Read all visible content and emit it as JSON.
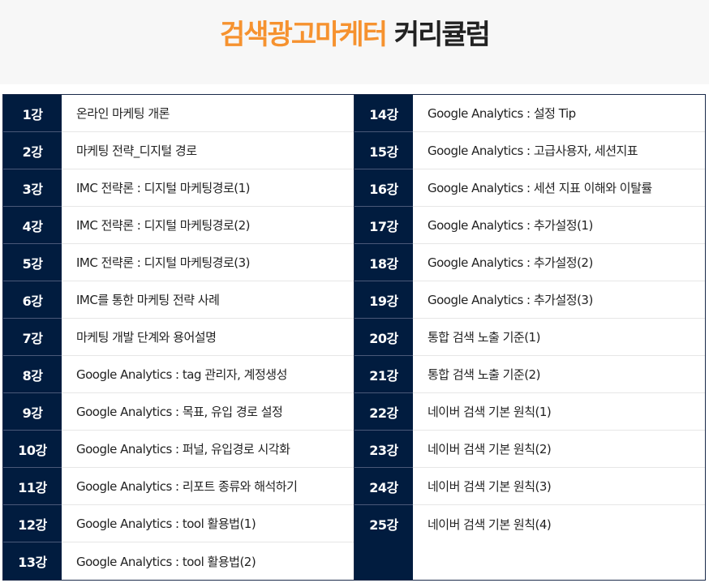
{
  "header": {
    "title_accent": "검색광고마케터",
    "title_rest": "커리큘럼",
    "accent_color": "#f6922f",
    "number_cell_color": "#011c3f"
  },
  "lessons_left": [
    {
      "num": "1강",
      "title": "온라인 마케팅 개론"
    },
    {
      "num": "2강",
      "title": "마케팅 전략_디지털 경로"
    },
    {
      "num": "3강",
      "title": "IMC 전략론 : 디지털 마케팅경로(1)"
    },
    {
      "num": "4강",
      "title": "IMC 전략론 : 디지털 마케팅경로(2)"
    },
    {
      "num": "5강",
      "title": "IMC 전략론 : 디지털 마케팅경로(3)"
    },
    {
      "num": "6강",
      "title": "IMC를 통한 마케팅 전략 사례"
    },
    {
      "num": "7강",
      "title": "마케팅 개발 단계와 용어설명"
    },
    {
      "num": "8강",
      "title": "Google Analytics : tag 관리자, 계정생성"
    },
    {
      "num": "9강",
      "title": "Google Analytics : 목표, 유입 경로 설정"
    },
    {
      "num": "10강",
      "title": "Google Analytics : 퍼널, 유입경로 시각화"
    },
    {
      "num": "11강",
      "title": "Google Analytics : 리포트 종류와 해석하기"
    },
    {
      "num": "12강",
      "title": "Google Analytics : tool 활용법(1)"
    },
    {
      "num": "13강",
      "title": "Google Analytics : tool 활용법(2)"
    }
  ],
  "lessons_right": [
    {
      "num": "14강",
      "title": "Google Analytics : 설정 Tip"
    },
    {
      "num": "15강",
      "title": "Google Analytics : 고급사용자, 세션지표"
    },
    {
      "num": "16강",
      "title": "Google Analytics : 세션 지표 이해와 이탈률"
    },
    {
      "num": "17강",
      "title": "Google Analytics : 추가설정(1)"
    },
    {
      "num": "18강",
      "title": "Google Analytics : 추가설정(2)"
    },
    {
      "num": "19강",
      "title": "Google Analytics : 추가설정(3)"
    },
    {
      "num": "20강",
      "title": "통합 검색 노출 기준(1)"
    },
    {
      "num": "21강",
      "title": "통합 검색 노출 기준(2)"
    },
    {
      "num": "22강",
      "title": "네이버 검색 기본 원칙(1)"
    },
    {
      "num": "23강",
      "title": "네이버 검색 기본 원칙(2)"
    },
    {
      "num": "24강",
      "title": "네이버 검색 기본 원칙(3)"
    },
    {
      "num": "25강",
      "title": "네이버 검색 기본 원칙(4)"
    }
  ]
}
